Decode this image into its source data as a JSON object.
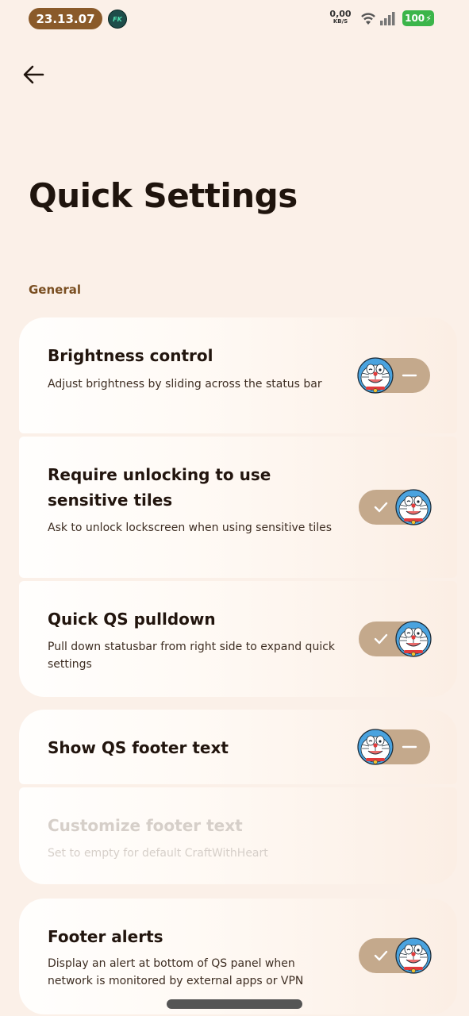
{
  "status_bar": {
    "time": "23.13.07",
    "app_badge": "FK",
    "net_speed_value": "0,00",
    "net_speed_unit": "KB/S",
    "battery_level": "100",
    "battery_color": "#3bb54a"
  },
  "header": {
    "back_icon": "arrow-left-icon",
    "title": "Quick Settings"
  },
  "sections": [
    {
      "label": "General",
      "items": [
        {
          "title": "Brightness control",
          "summary": "Adjust brightness by sliding across the status bar",
          "toggle": "off"
        },
        {
          "title": "Require unlocking to use sensitive tiles",
          "summary": "Ask to unlock lockscreen when using sensitive tiles",
          "toggle": "on"
        },
        {
          "title": "Quick QS pulldown",
          "summary": "Pull down statusbar from right side to expand quick settings",
          "toggle": "on"
        },
        {
          "title": "Show QS footer text",
          "summary": "",
          "toggle": "off"
        },
        {
          "title": "Customize footer text",
          "summary": "Set to empty for default CraftWithHeart",
          "enabled": false
        },
        {
          "title": "Footer alerts",
          "summary": "Display an alert at bottom of QS panel when network is monitored by external apps or VPN",
          "toggle": "on"
        }
      ]
    }
  ],
  "colors": {
    "background": "#fbf0e8",
    "accent": "#7a4f22",
    "toggle_track": "#c4a98c",
    "clock_pill": "#8a5a2a"
  }
}
